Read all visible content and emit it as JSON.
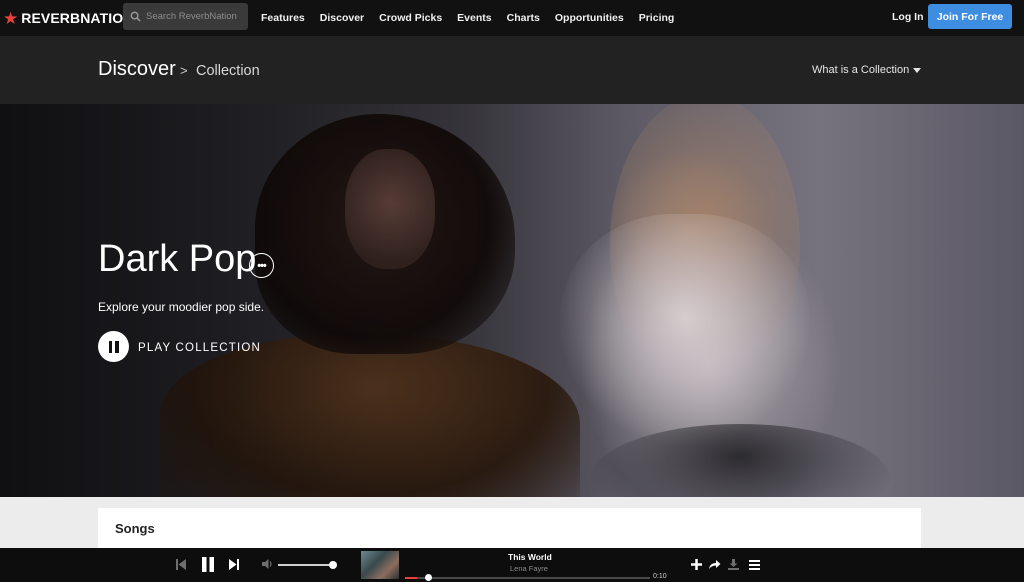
{
  "nav": {
    "logo_text": "REVERBNATION",
    "logo_mark": "®",
    "search_placeholder": "Search ReverbNation",
    "links": [
      "Features",
      "Discover",
      "Crowd Picks",
      "Events",
      "Charts",
      "Opportunities",
      "Pricing"
    ],
    "login_label": "Log In",
    "join_label": "Join For Free",
    "join_color": "#3d8de0",
    "brand_color": "#e8413c"
  },
  "breadcrumb": {
    "section": "Discover",
    "separator": ">",
    "page": "Collection",
    "help_link": "What is a Collection"
  },
  "hero": {
    "title": "Dark Pop",
    "more_label": "•••",
    "subtitle": "Explore your moodier pop side.",
    "play_label": "PLAY COLLECTION"
  },
  "songs": {
    "heading": "Songs"
  },
  "player": {
    "track_title": "This World",
    "artist": "Lena Fayre",
    "time": "0:10",
    "progress_fraction": 0.05,
    "volume_fraction": 0.95
  }
}
